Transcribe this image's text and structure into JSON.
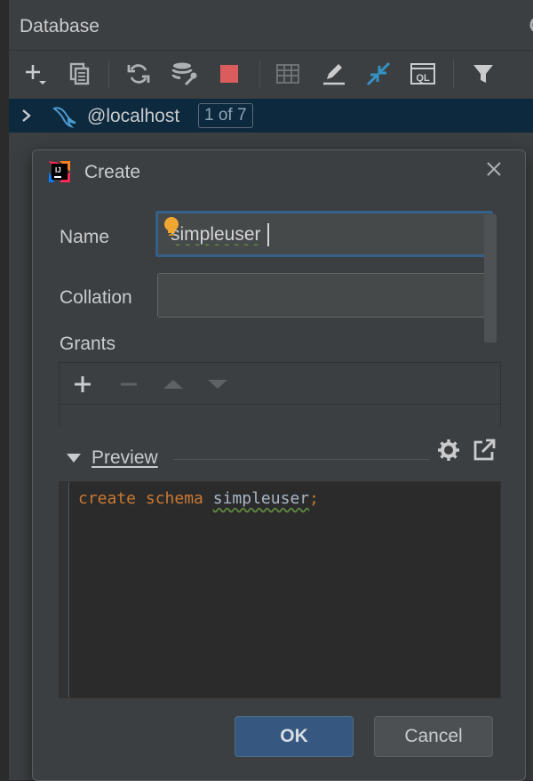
{
  "panel": {
    "title": "Database",
    "toolbar": [
      {
        "name": "add-icon"
      },
      {
        "name": "duplicate-icon"
      },
      {
        "name": "refresh-icon"
      },
      {
        "name": "properties-icon"
      },
      {
        "name": "stop-icon",
        "color": "#db5c5c"
      },
      {
        "name": "table-icon"
      },
      {
        "name": "edit-icon"
      },
      {
        "name": "jump-to-source-icon",
        "color": "#3592c4"
      },
      {
        "name": "query-console-icon"
      },
      {
        "name": "filter-icon"
      }
    ]
  },
  "tree": {
    "connection_label": "@localhost",
    "badge": "1 of 7"
  },
  "dialog": {
    "title": "Create",
    "name_label": "Name",
    "name_value": "simpleuser",
    "collation_label": "Collation",
    "collation_value": "",
    "grants_label": "Grants",
    "preview_label": "Preview",
    "code": {
      "kw1": "create",
      "kw2": "schema",
      "ident": "simpleuser",
      "terminator": ";"
    },
    "ok_label": "OK",
    "cancel_label": "Cancel"
  },
  "colors": {
    "accent": "#35608a",
    "keyword": "#cc7832",
    "ok_button": "#365880",
    "bulb": "#f0a732",
    "mysql_dolphin": "#4b9ad0"
  }
}
